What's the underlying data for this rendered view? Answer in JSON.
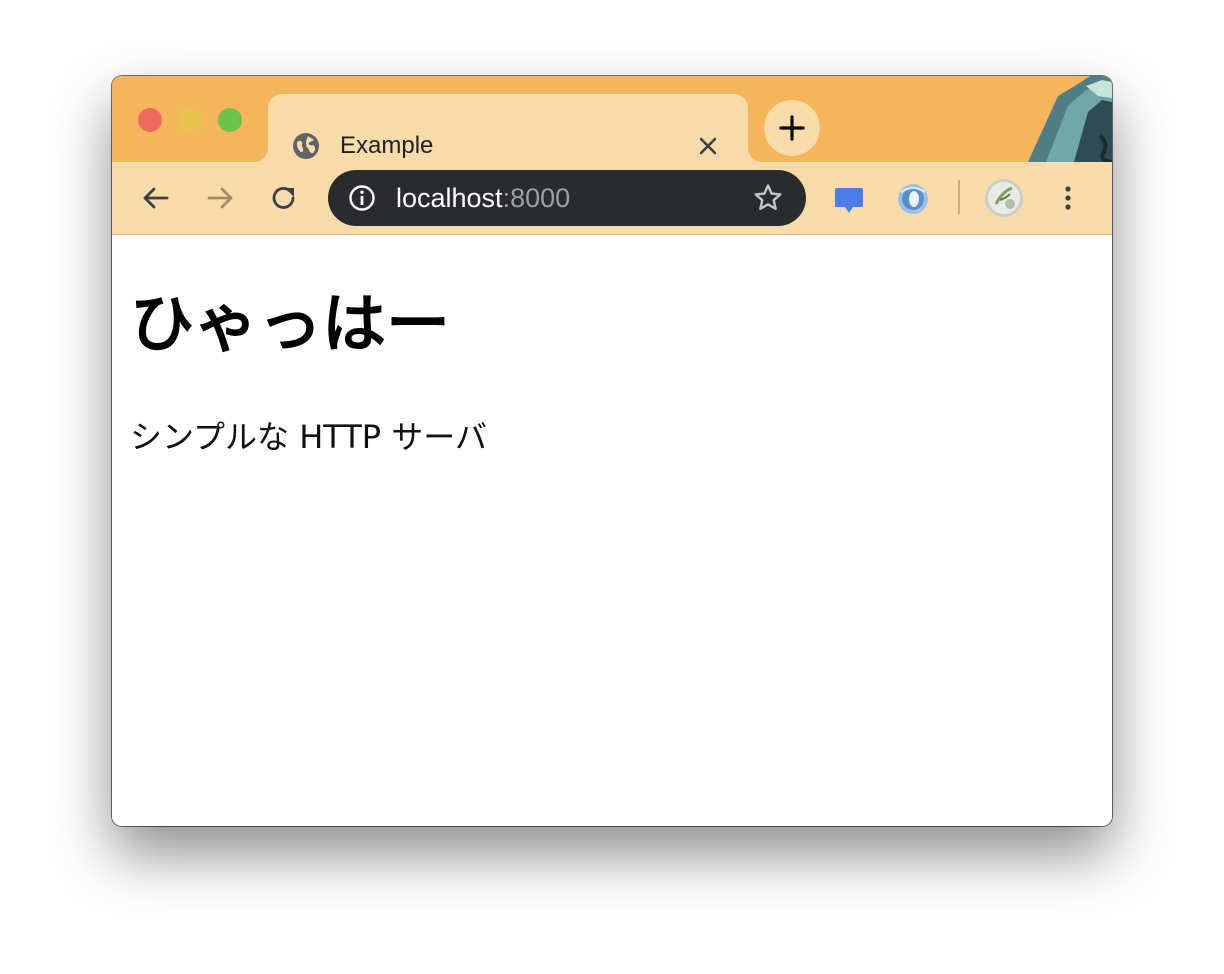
{
  "browser": {
    "tab": {
      "title": "Example",
      "favicon": "globe-icon"
    },
    "toolbar": {
      "back": "arrow-left-icon",
      "forward": "arrow-right-icon",
      "reload": "reload-icon",
      "menu": "kebab-menu-icon"
    },
    "omnibox": {
      "host": "localhost",
      "port": ":8000",
      "info": "info-icon",
      "bookmark": "star-icon"
    },
    "extensions": [
      "chat-extension-icon",
      "circular-extension-icon",
      "profile-avatar"
    ],
    "colors": {
      "frame": "#f4b55b",
      "tab": "#f7dca9",
      "omnibox": "#292b2e",
      "close": "#ee6a5f",
      "minimize": "#e7c24c",
      "maximize": "#6cc24a"
    }
  },
  "page": {
    "heading": "ひゃっはー",
    "text": "シンプルな HTTP サーバ"
  }
}
